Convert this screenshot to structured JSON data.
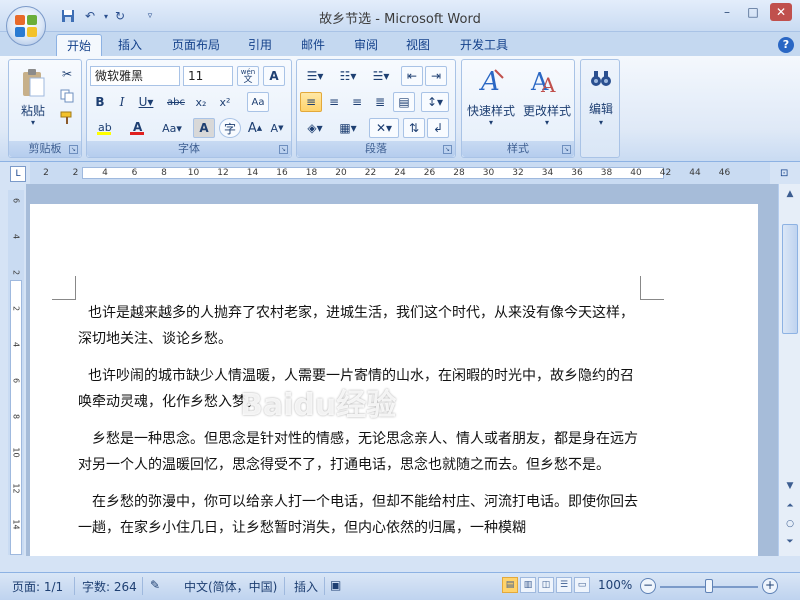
{
  "window": {
    "title": "故乡节选 - Microsoft Word",
    "controls": {
      "minimize": "–",
      "maximize": "□",
      "close": "✕"
    }
  },
  "qat": {
    "save_icon": "save-icon",
    "undo_icon": "undo-icon",
    "redo_icon": "redo-icon",
    "customize_icon": "customize-icon"
  },
  "tabs": [
    "开始",
    "插入",
    "页面布局",
    "引用",
    "邮件",
    "审阅",
    "视图",
    "开发工具"
  ],
  "active_tab": "开始",
  "ribbon": {
    "clipboard": {
      "label": "剪贴板",
      "paste": "粘贴"
    },
    "font": {
      "label": "字体",
      "font_name": "微软雅黑",
      "font_size": "11",
      "wen": "wén"
    },
    "paragraph": {
      "label": "段落"
    },
    "styles": {
      "label": "样式",
      "quick_styles": "快速样式",
      "change_styles": "更改样式"
    },
    "editing": {
      "label": "编辑"
    }
  },
  "ruler": {
    "numbers": [
      "2",
      "2",
      "4",
      "6",
      "8",
      "10",
      "12",
      "14",
      "16",
      "18",
      "20",
      "22",
      "24",
      "26",
      "28",
      "30",
      "32",
      "34",
      "36",
      "38",
      "40",
      "42",
      "44",
      "46"
    ],
    "vertical_numbers": [
      "6",
      "4",
      "2",
      "2",
      "4",
      "6",
      "8",
      "10",
      "12",
      "14"
    ]
  },
  "document": {
    "paragraphs": [
      "也许是越来越多的人抛弃了农村老家，进城生活，我们这个时代，从来没有像今天这样，深切地关注、谈论乡愁。",
      "也许吵闹的城市缺少人情温暖，人需要一片寄情的山水，在闲暇的时光中，故乡隐约的召唤牵动灵魂，化作乡愁入梦。",
      "乡愁是一种思念。但思念是针对性的情感，无论思念亲人、情人或者朋友，都是身在远方对另一个人的温暖回忆，思念得受不了，打通电话，思念也就随之而去。但乡愁不是。",
      "在乡愁的弥漫中，你可以给亲人打一个电话，但却不能给村庄、河流打电话。即使你回去一趟，在家乡小住几日，让乡愁暂时消失，但内心依然的归属，一种模糊"
    ]
  },
  "statusbar": {
    "page": "页面: 1/1",
    "words": "字数: 264",
    "language": "中文(简体，中国)",
    "mode": "插入",
    "zoom": "100%",
    "zoom_level": 0.5
  },
  "watermark": "Baidu经验"
}
